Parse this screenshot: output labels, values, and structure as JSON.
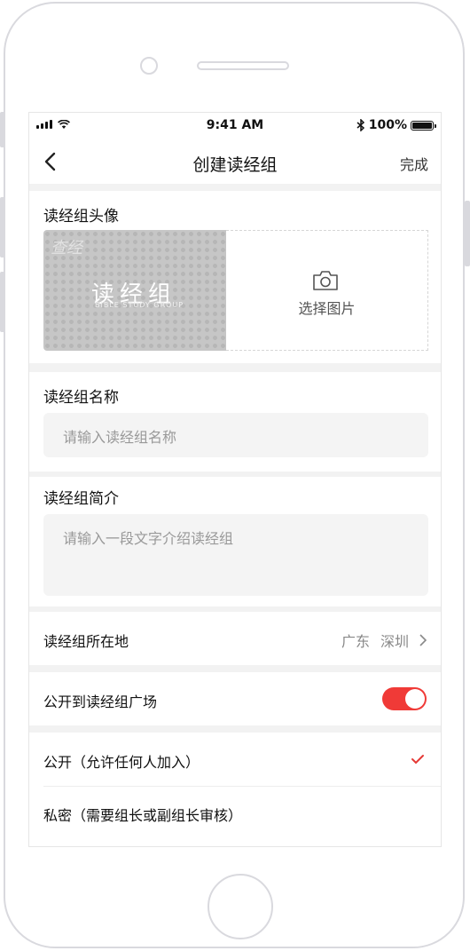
{
  "status": {
    "time": "9:41 AM",
    "battery": "100%"
  },
  "nav": {
    "title": "创建读经组",
    "done": "完成"
  },
  "avatar": {
    "label": "读经组头像",
    "image_title": "读经组",
    "image_subtitle": "BIBLE STUDY GROUP",
    "image_watermark": "查经",
    "choose_label": "选择图片"
  },
  "name": {
    "label": "读经组名称",
    "placeholder": "请输入读经组名称"
  },
  "intro": {
    "label": "读经组简介",
    "placeholder": "请输入一段文字介绍读经组"
  },
  "location": {
    "label": "读经组所在地",
    "province": "广东",
    "city": "深圳"
  },
  "public_square": {
    "label": "公开到读经组广场",
    "enabled": true,
    "color": "#f03a37"
  },
  "privacy": {
    "options": [
      {
        "label": "公开（允许任何人加入）",
        "selected": true
      },
      {
        "label": "私密（需要组长或副组长审核）",
        "selected": false
      }
    ],
    "check_color": "#e53935"
  }
}
